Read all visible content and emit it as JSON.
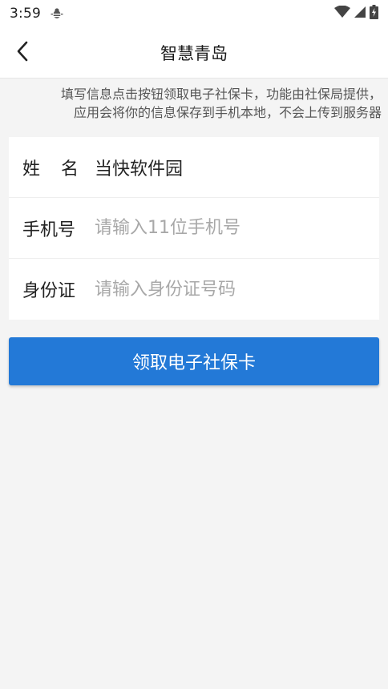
{
  "status_bar": {
    "time": "3:59",
    "icons": [
      "debug-bug-icon",
      "wifi-icon",
      "cellular-signal-icon",
      "battery-charging-icon"
    ]
  },
  "app_bar": {
    "title": "智慧青岛",
    "back_icon": "chevron-left-icon"
  },
  "notice": {
    "line1": "填写信息点击按钮领取电子社保卡，功能由社保局提供，",
    "line2": "应用会将你的信息保存到手机本地，不会上传到服务器"
  },
  "form": {
    "name": {
      "label_part1": "姓",
      "label_part2": "名",
      "value": "当快软件园",
      "placeholder": ""
    },
    "phone": {
      "label": "手机号",
      "value": "",
      "placeholder": "请输入11位手机号"
    },
    "id_card": {
      "label": "身份证",
      "value": "",
      "placeholder": "请输入身份证号码"
    }
  },
  "submit": {
    "label": "领取电子社保卡"
  },
  "colors": {
    "accent": "#2379d7",
    "background": "#f4f4f4",
    "card": "#ffffff",
    "placeholder": "#a8a8a8"
  }
}
